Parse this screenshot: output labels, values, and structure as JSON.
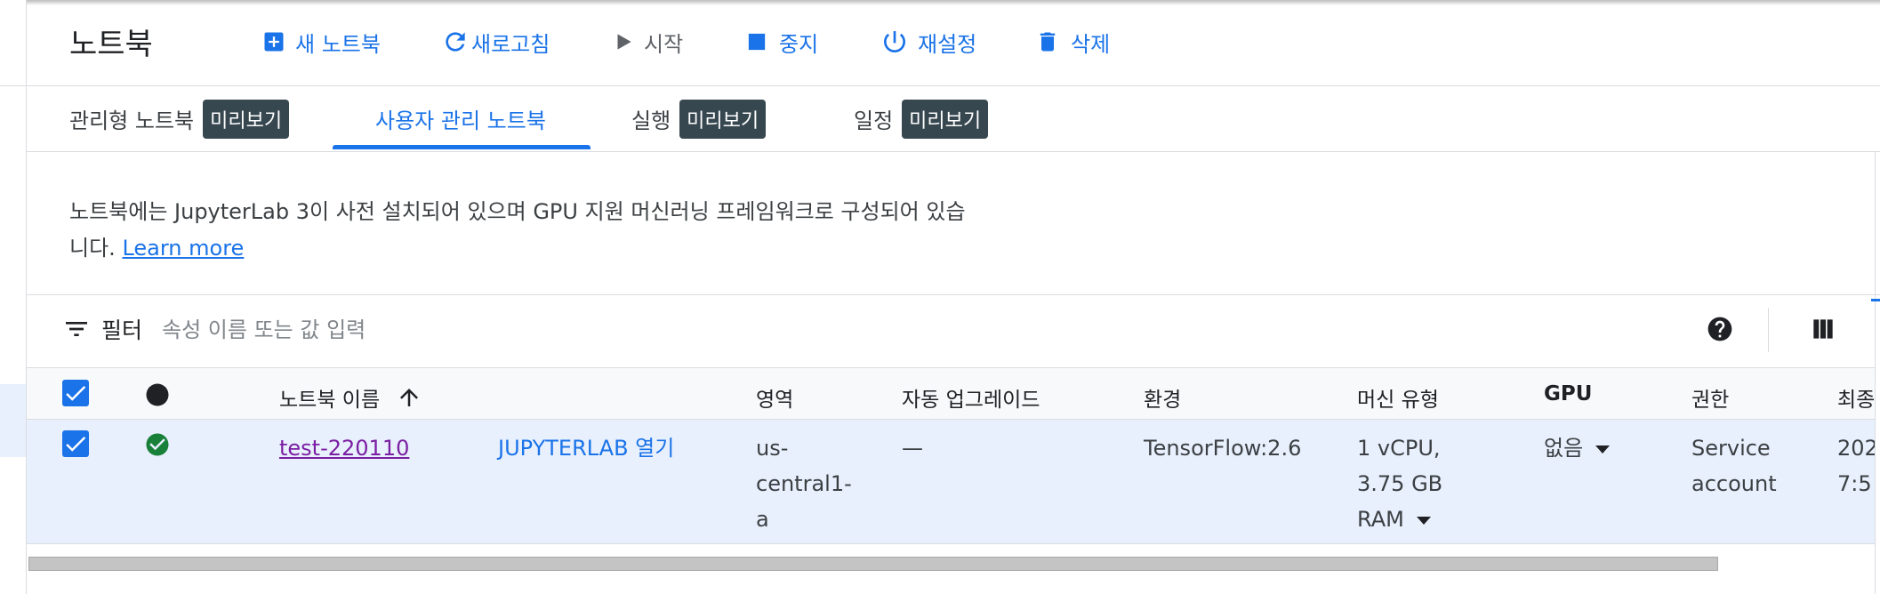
{
  "toolbar": {
    "title": "노트북",
    "new_notebook": "새 노트북",
    "refresh": "새로고침",
    "start": "시작",
    "stop": "중지",
    "reset": "재설정",
    "delete": "삭제",
    "accent_color": "#1a73e8"
  },
  "tabs": [
    {
      "label": "관리형 노트북",
      "badge": "미리보기"
    },
    {
      "label": "사용자 관리 노트북"
    },
    {
      "label": "실행",
      "badge": "미리보기"
    },
    {
      "label": "일정",
      "badge": "미리보기"
    }
  ],
  "info": {
    "text_line1": "노트북에는 JupyterLab 3이 사전 설치되어 있으며 GPU 지원 머신러닝 프레임워크로 구성되어 있습",
    "text_line2": "니다.",
    "learn_more": "Learn more"
  },
  "filter": {
    "label": "필터",
    "placeholder": "속성 이름 또는 값 입력"
  },
  "table": {
    "columns": {
      "name": "노트북 이름",
      "zone": "영역",
      "auto_upgrade": "자동 업그레이드",
      "environment": "환경",
      "machine_type": "머신 유형",
      "gpu": "GPU",
      "permission": "권한",
      "last": "최종"
    },
    "rows": [
      {
        "name": "test-220110",
        "open_action": "JUPYTERLAB 열기",
        "zone": [
          "us-",
          "central1-",
          "a"
        ],
        "auto_upgrade": "—",
        "environment": "TensorFlow:2.6",
        "machine_type": [
          "1 vCPU,",
          "3.75 GB",
          "RAM"
        ],
        "gpu": "없음",
        "permission": [
          "Service",
          "account"
        ],
        "last": [
          "202",
          "7:5"
        ]
      }
    ]
  }
}
